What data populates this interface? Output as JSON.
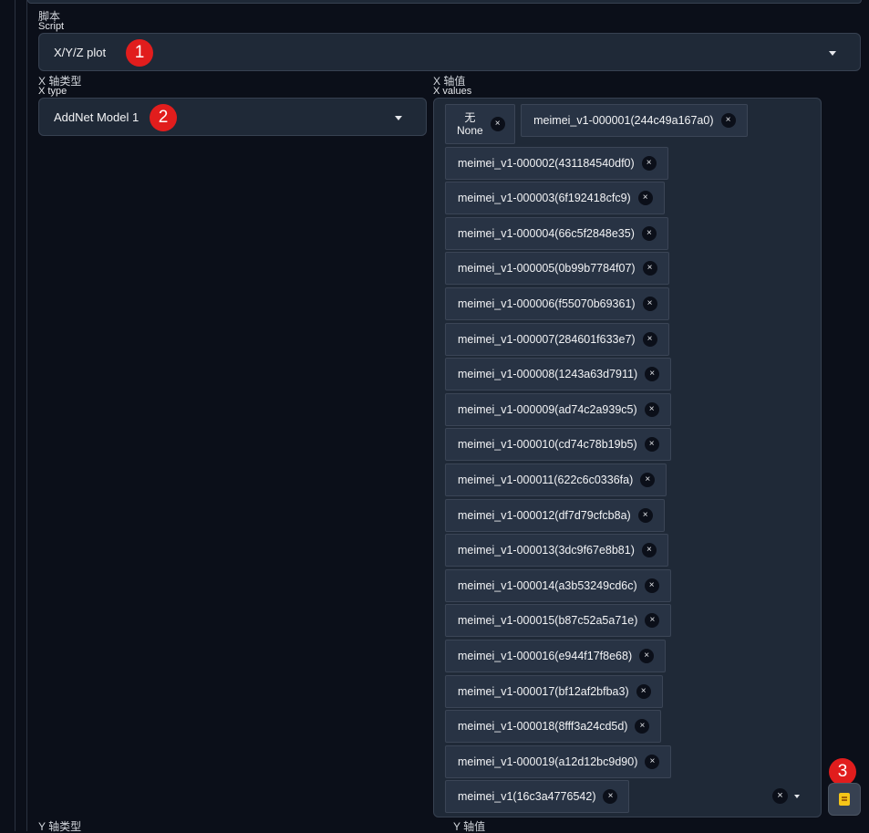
{
  "script": {
    "label_cn": "脚本",
    "label_en": "Script",
    "value": "X/Y/Z plot",
    "annotation": "1"
  },
  "x_type": {
    "label_cn": "X 轴类型",
    "label_en": "X type",
    "value": "AddNet Model 1",
    "annotation": "2"
  },
  "x_values": {
    "label_cn": "X 轴值",
    "label_en": "X values",
    "first_chip": {
      "cn": "无",
      "en": "None"
    },
    "chips": [
      "meimei_v1-000001(244c49a167a0)",
      "meimei_v1-000002(431184540df0)",
      "meimei_v1-000003(6f192418cfc9)",
      "meimei_v1-000004(66c5f2848e35)",
      "meimei_v1-000005(0b99b7784f07)",
      "meimei_v1-000006(f55070b69361)",
      "meimei_v1-000007(284601f633e7)",
      "meimei_v1-000008(1243a63d7911)",
      "meimei_v1-000009(ad74c2a939c5)",
      "meimei_v1-000010(cd74c78b19b5)",
      "meimei_v1-000011(622c6c0336fa)",
      "meimei_v1-000012(df7d79cfcb8a)",
      "meimei_v1-000013(3dc9f67e8b81)",
      "meimei_v1-000014(a3b53249cd6c)",
      "meimei_v1-000015(b87c52a5a71e)",
      "meimei_v1-000016(e944f17f8e68)",
      "meimei_v1-000017(bf12af2bfba3)",
      "meimei_v1-000018(8fff3a24cd5d)",
      "meimei_v1-000019(a12d12bc9d90)",
      "meimei_v1(16c3a4776542)"
    ],
    "remove_symbol": "×",
    "clear_symbol": "×"
  },
  "tool_button": {
    "annotation": "3",
    "icon": "notepad-icon"
  },
  "y_type": {
    "label_cn": "Y 轴类型"
  },
  "y_values": {
    "label_cn": "Y 轴值"
  },
  "colors": {
    "background": "#0b0f19",
    "panel": "#1f2937",
    "chip": "#283344",
    "badge": "#e11d1d",
    "icon": "#f5c518"
  }
}
